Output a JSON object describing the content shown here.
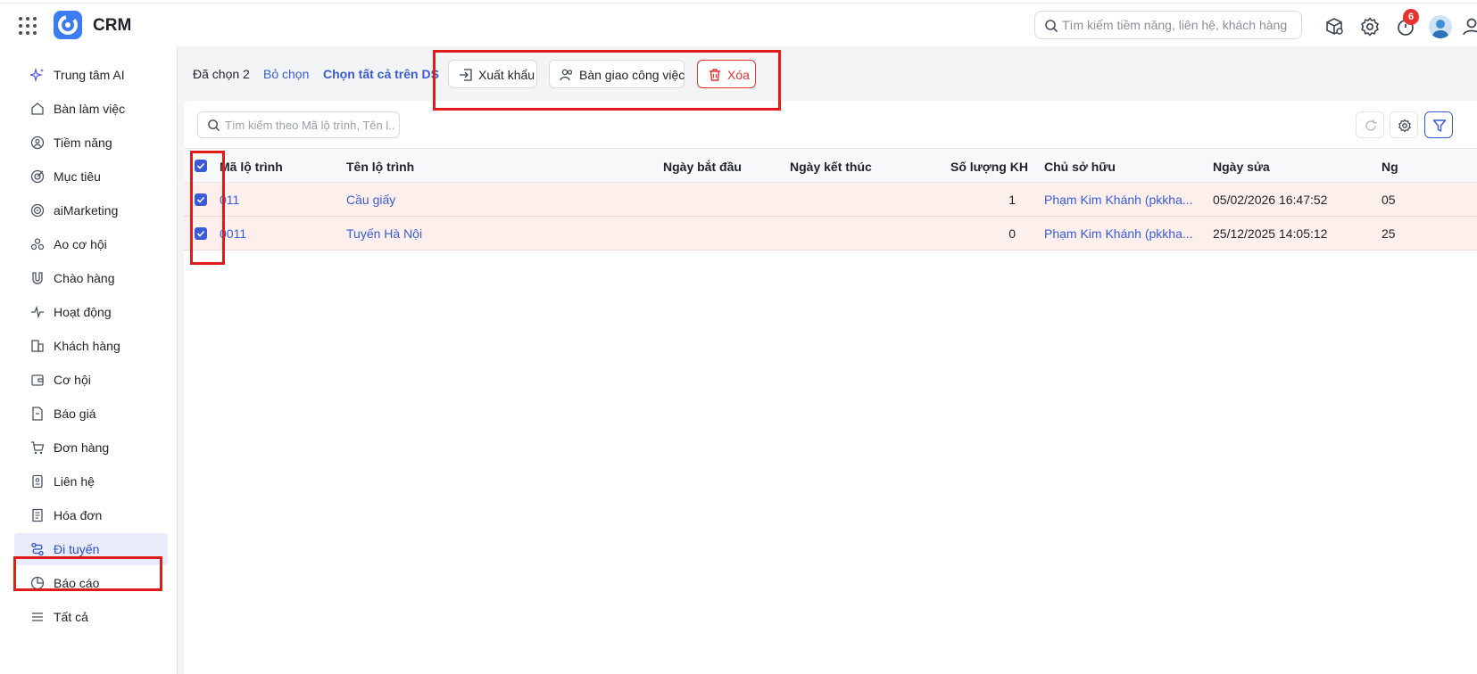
{
  "header": {
    "app_title": "CRM",
    "search_placeholder": "Tìm kiếm tiềm năng, liên hệ, khách hàng",
    "notification_count": "6",
    "accent_color": "#3a5bd9",
    "badge_color": "#e5332e"
  },
  "sidebar": {
    "items": [
      {
        "label": "Trung tâm AI",
        "icon": "sparkle-icon"
      },
      {
        "label": "Bàn làm việc",
        "icon": "home-icon"
      },
      {
        "label": "Tiềm năng",
        "icon": "lead-icon"
      },
      {
        "label": "Mục tiêu",
        "icon": "target-icon"
      },
      {
        "label": "aiMarketing",
        "icon": "marketing-icon"
      },
      {
        "label": "Ao cơ hội",
        "icon": "pool-icon"
      },
      {
        "label": "Chào hàng",
        "icon": "magnet-icon"
      },
      {
        "label": "Hoạt động",
        "icon": "activity-icon"
      },
      {
        "label": "Khách hàng",
        "icon": "building-icon"
      },
      {
        "label": "Cơ hội",
        "icon": "wallet-icon"
      },
      {
        "label": "Báo giá",
        "icon": "quote-icon"
      },
      {
        "label": "Đơn hàng",
        "icon": "cart-icon"
      },
      {
        "label": "Liên hệ",
        "icon": "contact-icon"
      },
      {
        "label": "Hóa đơn",
        "icon": "invoice-icon"
      },
      {
        "label": "Đi tuyến",
        "icon": "route-icon",
        "active": true
      },
      {
        "label": "Báo cáo",
        "icon": "chart-pie-icon"
      },
      {
        "label": "Tất cả",
        "icon": "menu-icon"
      }
    ]
  },
  "bulk": {
    "selected_text": "Đã chọn 2",
    "deselect_label": "Bỏ chọn",
    "select_all_label": "Chọn tất cả trên DS",
    "export_label": "Xuất khẩu",
    "handover_label": "Bàn giao công việc",
    "delete_label": "Xóa"
  },
  "grid": {
    "search_placeholder": "Tìm kiếm theo Mã lộ trình, Tên l...",
    "columns": [
      "Mã lộ trình",
      "Tên lộ trình",
      "Ngày bắt đầu",
      "Ngày kết thúc",
      "Số lượng KH",
      "Chủ sở hữu",
      "Ngày sửa",
      "Ng"
    ],
    "rows": [
      {
        "code": "011",
        "name": "Cầu giấy",
        "start": "",
        "end": "",
        "count": "1",
        "owner": "Phạm Kim Khánh (pkkha...",
        "modified": "05/02/2026 16:47:52",
        "extra": "05",
        "checked": true
      },
      {
        "code": "0011",
        "name": "Tuyến Hà Nội",
        "start": "",
        "end": "",
        "count": "0",
        "owner": "Phạm Kim Khánh (pkkha...",
        "modified": "25/12/2025 14:05:12",
        "extra": "25",
        "checked": true
      }
    ]
  }
}
